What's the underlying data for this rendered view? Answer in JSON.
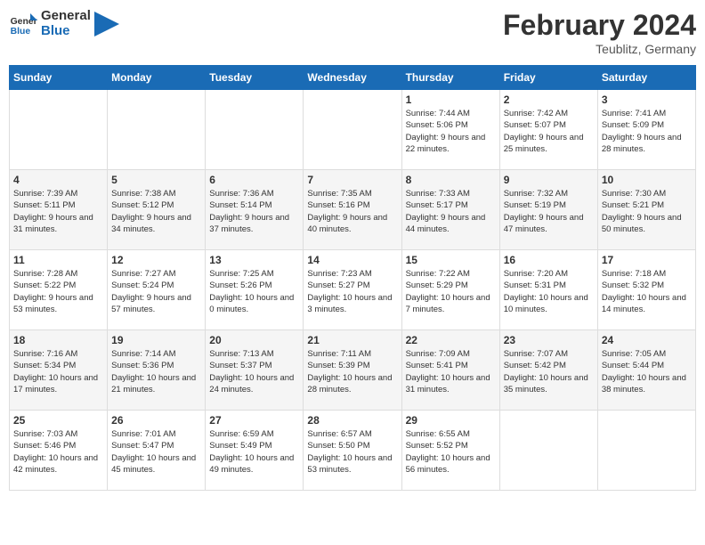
{
  "header": {
    "logo_general": "General",
    "logo_blue": "Blue",
    "month_year": "February 2024",
    "location": "Teublitz, Germany"
  },
  "days_of_week": [
    "Sunday",
    "Monday",
    "Tuesday",
    "Wednesday",
    "Thursday",
    "Friday",
    "Saturday"
  ],
  "weeks": [
    [
      {
        "day": "",
        "info": ""
      },
      {
        "day": "",
        "info": ""
      },
      {
        "day": "",
        "info": ""
      },
      {
        "day": "",
        "info": ""
      },
      {
        "day": "1",
        "info": "Sunrise: 7:44 AM\nSunset: 5:06 PM\nDaylight: 9 hours\nand 22 minutes."
      },
      {
        "day": "2",
        "info": "Sunrise: 7:42 AM\nSunset: 5:07 PM\nDaylight: 9 hours\nand 25 minutes."
      },
      {
        "day": "3",
        "info": "Sunrise: 7:41 AM\nSunset: 5:09 PM\nDaylight: 9 hours\nand 28 minutes."
      }
    ],
    [
      {
        "day": "4",
        "info": "Sunrise: 7:39 AM\nSunset: 5:11 PM\nDaylight: 9 hours\nand 31 minutes."
      },
      {
        "day": "5",
        "info": "Sunrise: 7:38 AM\nSunset: 5:12 PM\nDaylight: 9 hours\nand 34 minutes."
      },
      {
        "day": "6",
        "info": "Sunrise: 7:36 AM\nSunset: 5:14 PM\nDaylight: 9 hours\nand 37 minutes."
      },
      {
        "day": "7",
        "info": "Sunrise: 7:35 AM\nSunset: 5:16 PM\nDaylight: 9 hours\nand 40 minutes."
      },
      {
        "day": "8",
        "info": "Sunrise: 7:33 AM\nSunset: 5:17 PM\nDaylight: 9 hours\nand 44 minutes."
      },
      {
        "day": "9",
        "info": "Sunrise: 7:32 AM\nSunset: 5:19 PM\nDaylight: 9 hours\nand 47 minutes."
      },
      {
        "day": "10",
        "info": "Sunrise: 7:30 AM\nSunset: 5:21 PM\nDaylight: 9 hours\nand 50 minutes."
      }
    ],
    [
      {
        "day": "11",
        "info": "Sunrise: 7:28 AM\nSunset: 5:22 PM\nDaylight: 9 hours\nand 53 minutes."
      },
      {
        "day": "12",
        "info": "Sunrise: 7:27 AM\nSunset: 5:24 PM\nDaylight: 9 hours\nand 57 minutes."
      },
      {
        "day": "13",
        "info": "Sunrise: 7:25 AM\nSunset: 5:26 PM\nDaylight: 10 hours\nand 0 minutes."
      },
      {
        "day": "14",
        "info": "Sunrise: 7:23 AM\nSunset: 5:27 PM\nDaylight: 10 hours\nand 3 minutes."
      },
      {
        "day": "15",
        "info": "Sunrise: 7:22 AM\nSunset: 5:29 PM\nDaylight: 10 hours\nand 7 minutes."
      },
      {
        "day": "16",
        "info": "Sunrise: 7:20 AM\nSunset: 5:31 PM\nDaylight: 10 hours\nand 10 minutes."
      },
      {
        "day": "17",
        "info": "Sunrise: 7:18 AM\nSunset: 5:32 PM\nDaylight: 10 hours\nand 14 minutes."
      }
    ],
    [
      {
        "day": "18",
        "info": "Sunrise: 7:16 AM\nSunset: 5:34 PM\nDaylight: 10 hours\nand 17 minutes."
      },
      {
        "day": "19",
        "info": "Sunrise: 7:14 AM\nSunset: 5:36 PM\nDaylight: 10 hours\nand 21 minutes."
      },
      {
        "day": "20",
        "info": "Sunrise: 7:13 AM\nSunset: 5:37 PM\nDaylight: 10 hours\nand 24 minutes."
      },
      {
        "day": "21",
        "info": "Sunrise: 7:11 AM\nSunset: 5:39 PM\nDaylight: 10 hours\nand 28 minutes."
      },
      {
        "day": "22",
        "info": "Sunrise: 7:09 AM\nSunset: 5:41 PM\nDaylight: 10 hours\nand 31 minutes."
      },
      {
        "day": "23",
        "info": "Sunrise: 7:07 AM\nSunset: 5:42 PM\nDaylight: 10 hours\nand 35 minutes."
      },
      {
        "day": "24",
        "info": "Sunrise: 7:05 AM\nSunset: 5:44 PM\nDaylight: 10 hours\nand 38 minutes."
      }
    ],
    [
      {
        "day": "25",
        "info": "Sunrise: 7:03 AM\nSunset: 5:46 PM\nDaylight: 10 hours\nand 42 minutes."
      },
      {
        "day": "26",
        "info": "Sunrise: 7:01 AM\nSunset: 5:47 PM\nDaylight: 10 hours\nand 45 minutes."
      },
      {
        "day": "27",
        "info": "Sunrise: 6:59 AM\nSunset: 5:49 PM\nDaylight: 10 hours\nand 49 minutes."
      },
      {
        "day": "28",
        "info": "Sunrise: 6:57 AM\nSunset: 5:50 PM\nDaylight: 10 hours\nand 53 minutes."
      },
      {
        "day": "29",
        "info": "Sunrise: 6:55 AM\nSunset: 5:52 PM\nDaylight: 10 hours\nand 56 minutes."
      },
      {
        "day": "",
        "info": ""
      },
      {
        "day": "",
        "info": ""
      }
    ]
  ]
}
